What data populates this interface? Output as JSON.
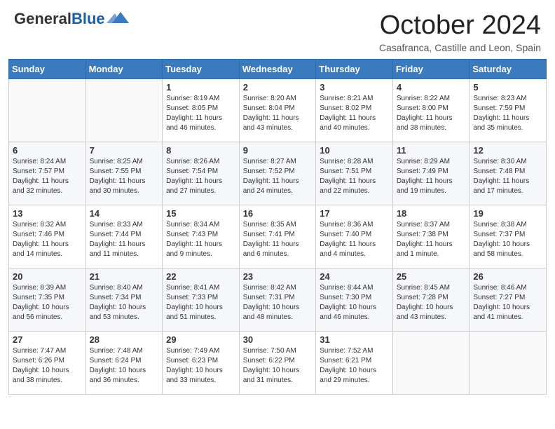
{
  "header": {
    "logo_general": "General",
    "logo_blue": "Blue",
    "month_title": "October 2024",
    "subtitle": "Casafranca, Castille and Leon, Spain"
  },
  "days_of_week": [
    "Sunday",
    "Monday",
    "Tuesday",
    "Wednesday",
    "Thursday",
    "Friday",
    "Saturday"
  ],
  "weeks": [
    [
      {
        "day": "",
        "text": ""
      },
      {
        "day": "",
        "text": ""
      },
      {
        "day": "1",
        "text": "Sunrise: 8:19 AM\nSunset: 8:05 PM\nDaylight: 11 hours and 46 minutes."
      },
      {
        "day": "2",
        "text": "Sunrise: 8:20 AM\nSunset: 8:04 PM\nDaylight: 11 hours and 43 minutes."
      },
      {
        "day": "3",
        "text": "Sunrise: 8:21 AM\nSunset: 8:02 PM\nDaylight: 11 hours and 40 minutes."
      },
      {
        "day": "4",
        "text": "Sunrise: 8:22 AM\nSunset: 8:00 PM\nDaylight: 11 hours and 38 minutes."
      },
      {
        "day": "5",
        "text": "Sunrise: 8:23 AM\nSunset: 7:59 PM\nDaylight: 11 hours and 35 minutes."
      }
    ],
    [
      {
        "day": "6",
        "text": "Sunrise: 8:24 AM\nSunset: 7:57 PM\nDaylight: 11 hours and 32 minutes."
      },
      {
        "day": "7",
        "text": "Sunrise: 8:25 AM\nSunset: 7:55 PM\nDaylight: 11 hours and 30 minutes."
      },
      {
        "day": "8",
        "text": "Sunrise: 8:26 AM\nSunset: 7:54 PM\nDaylight: 11 hours and 27 minutes."
      },
      {
        "day": "9",
        "text": "Sunrise: 8:27 AM\nSunset: 7:52 PM\nDaylight: 11 hours and 24 minutes."
      },
      {
        "day": "10",
        "text": "Sunrise: 8:28 AM\nSunset: 7:51 PM\nDaylight: 11 hours and 22 minutes."
      },
      {
        "day": "11",
        "text": "Sunrise: 8:29 AM\nSunset: 7:49 PM\nDaylight: 11 hours and 19 minutes."
      },
      {
        "day": "12",
        "text": "Sunrise: 8:30 AM\nSunset: 7:48 PM\nDaylight: 11 hours and 17 minutes."
      }
    ],
    [
      {
        "day": "13",
        "text": "Sunrise: 8:32 AM\nSunset: 7:46 PM\nDaylight: 11 hours and 14 minutes."
      },
      {
        "day": "14",
        "text": "Sunrise: 8:33 AM\nSunset: 7:44 PM\nDaylight: 11 hours and 11 minutes."
      },
      {
        "day": "15",
        "text": "Sunrise: 8:34 AM\nSunset: 7:43 PM\nDaylight: 11 hours and 9 minutes."
      },
      {
        "day": "16",
        "text": "Sunrise: 8:35 AM\nSunset: 7:41 PM\nDaylight: 11 hours and 6 minutes."
      },
      {
        "day": "17",
        "text": "Sunrise: 8:36 AM\nSunset: 7:40 PM\nDaylight: 11 hours and 4 minutes."
      },
      {
        "day": "18",
        "text": "Sunrise: 8:37 AM\nSunset: 7:38 PM\nDaylight: 11 hours and 1 minute."
      },
      {
        "day": "19",
        "text": "Sunrise: 8:38 AM\nSunset: 7:37 PM\nDaylight: 10 hours and 58 minutes."
      }
    ],
    [
      {
        "day": "20",
        "text": "Sunrise: 8:39 AM\nSunset: 7:35 PM\nDaylight: 10 hours and 56 minutes."
      },
      {
        "day": "21",
        "text": "Sunrise: 8:40 AM\nSunset: 7:34 PM\nDaylight: 10 hours and 53 minutes."
      },
      {
        "day": "22",
        "text": "Sunrise: 8:41 AM\nSunset: 7:33 PM\nDaylight: 10 hours and 51 minutes."
      },
      {
        "day": "23",
        "text": "Sunrise: 8:42 AM\nSunset: 7:31 PM\nDaylight: 10 hours and 48 minutes."
      },
      {
        "day": "24",
        "text": "Sunrise: 8:44 AM\nSunset: 7:30 PM\nDaylight: 10 hours and 46 minutes."
      },
      {
        "day": "25",
        "text": "Sunrise: 8:45 AM\nSunset: 7:28 PM\nDaylight: 10 hours and 43 minutes."
      },
      {
        "day": "26",
        "text": "Sunrise: 8:46 AM\nSunset: 7:27 PM\nDaylight: 10 hours and 41 minutes."
      }
    ],
    [
      {
        "day": "27",
        "text": "Sunrise: 7:47 AM\nSunset: 6:26 PM\nDaylight: 10 hours and 38 minutes."
      },
      {
        "day": "28",
        "text": "Sunrise: 7:48 AM\nSunset: 6:24 PM\nDaylight: 10 hours and 36 minutes."
      },
      {
        "day": "29",
        "text": "Sunrise: 7:49 AM\nSunset: 6:23 PM\nDaylight: 10 hours and 33 minutes."
      },
      {
        "day": "30",
        "text": "Sunrise: 7:50 AM\nSunset: 6:22 PM\nDaylight: 10 hours and 31 minutes."
      },
      {
        "day": "31",
        "text": "Sunrise: 7:52 AM\nSunset: 6:21 PM\nDaylight: 10 hours and 29 minutes."
      },
      {
        "day": "",
        "text": ""
      },
      {
        "day": "",
        "text": ""
      }
    ]
  ]
}
